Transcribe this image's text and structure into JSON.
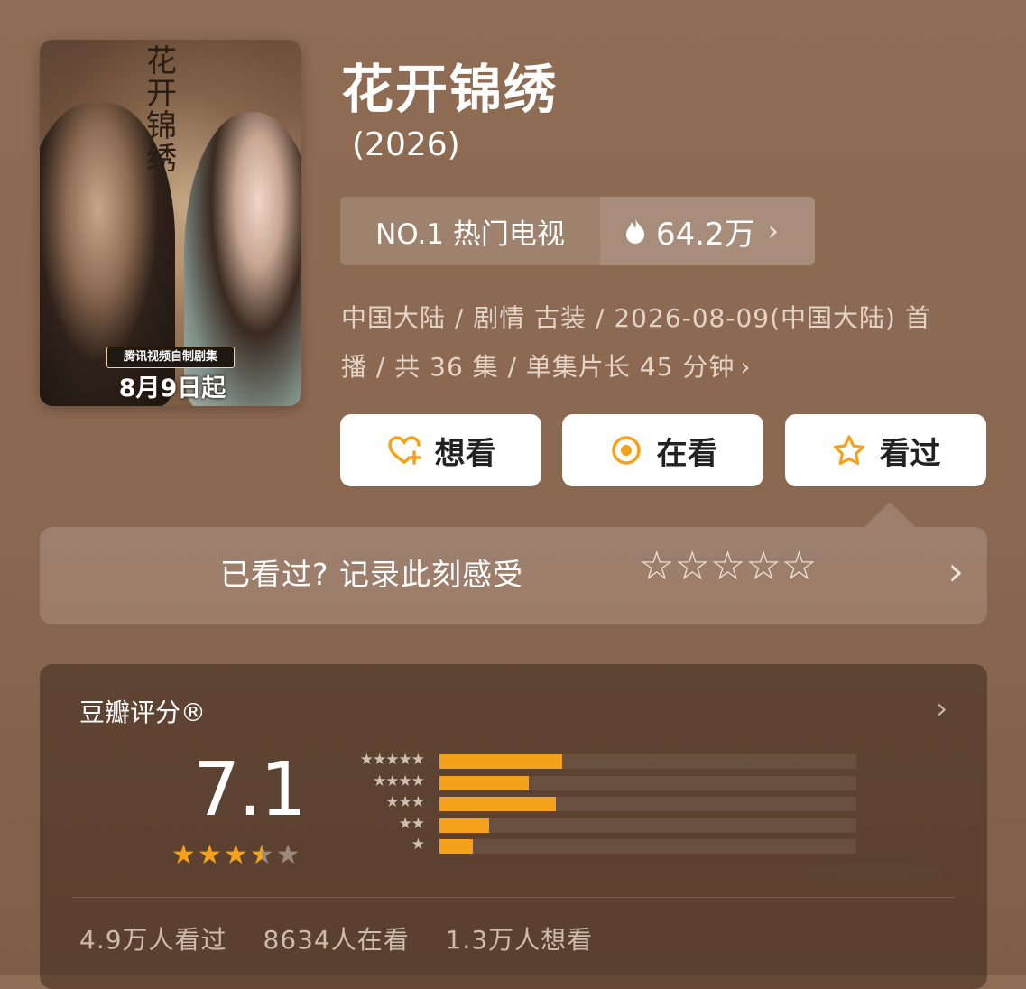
{
  "poster": {
    "title": "花开锦绣",
    "badge": "腾讯视频自制剧集",
    "date": "8月9日起"
  },
  "title": "花开锦绣",
  "year": "(2026)",
  "rank": {
    "label": "NO.1 热门电视",
    "heat": "64.2万"
  },
  "meta": {
    "line1": "中国大陆 / 剧情 古装 / 2026-08-09(中国大陆) 首",
    "line2": "播 / 共 36 集 / 单集片长 45 分钟"
  },
  "actions": {
    "want": "想看",
    "watching": "在看",
    "watched": "看过"
  },
  "record": {
    "prompt": "已看过? 记录此刻感受",
    "stars": "☆☆☆☆☆"
  },
  "rating": {
    "label": "豆瓣评分®",
    "score": "7.1",
    "stars_value": 3.5,
    "distribution": [
      {
        "stars": "★★★★★",
        "percent": 0.295
      },
      {
        "stars": "★★★★",
        "percent": 0.215
      },
      {
        "stars": "★★★",
        "percent": 0.28
      },
      {
        "stars": "★★",
        "percent": 0.12
      },
      {
        "stars": "★",
        "percent": 0.08
      }
    ],
    "stats": {
      "watched": "4.9万人看过",
      "watching": "8634人在看",
      "want": "1.3万人想看"
    }
  },
  "colors": {
    "accent": "#f4a21a",
    "bg": "#8f6c54"
  }
}
